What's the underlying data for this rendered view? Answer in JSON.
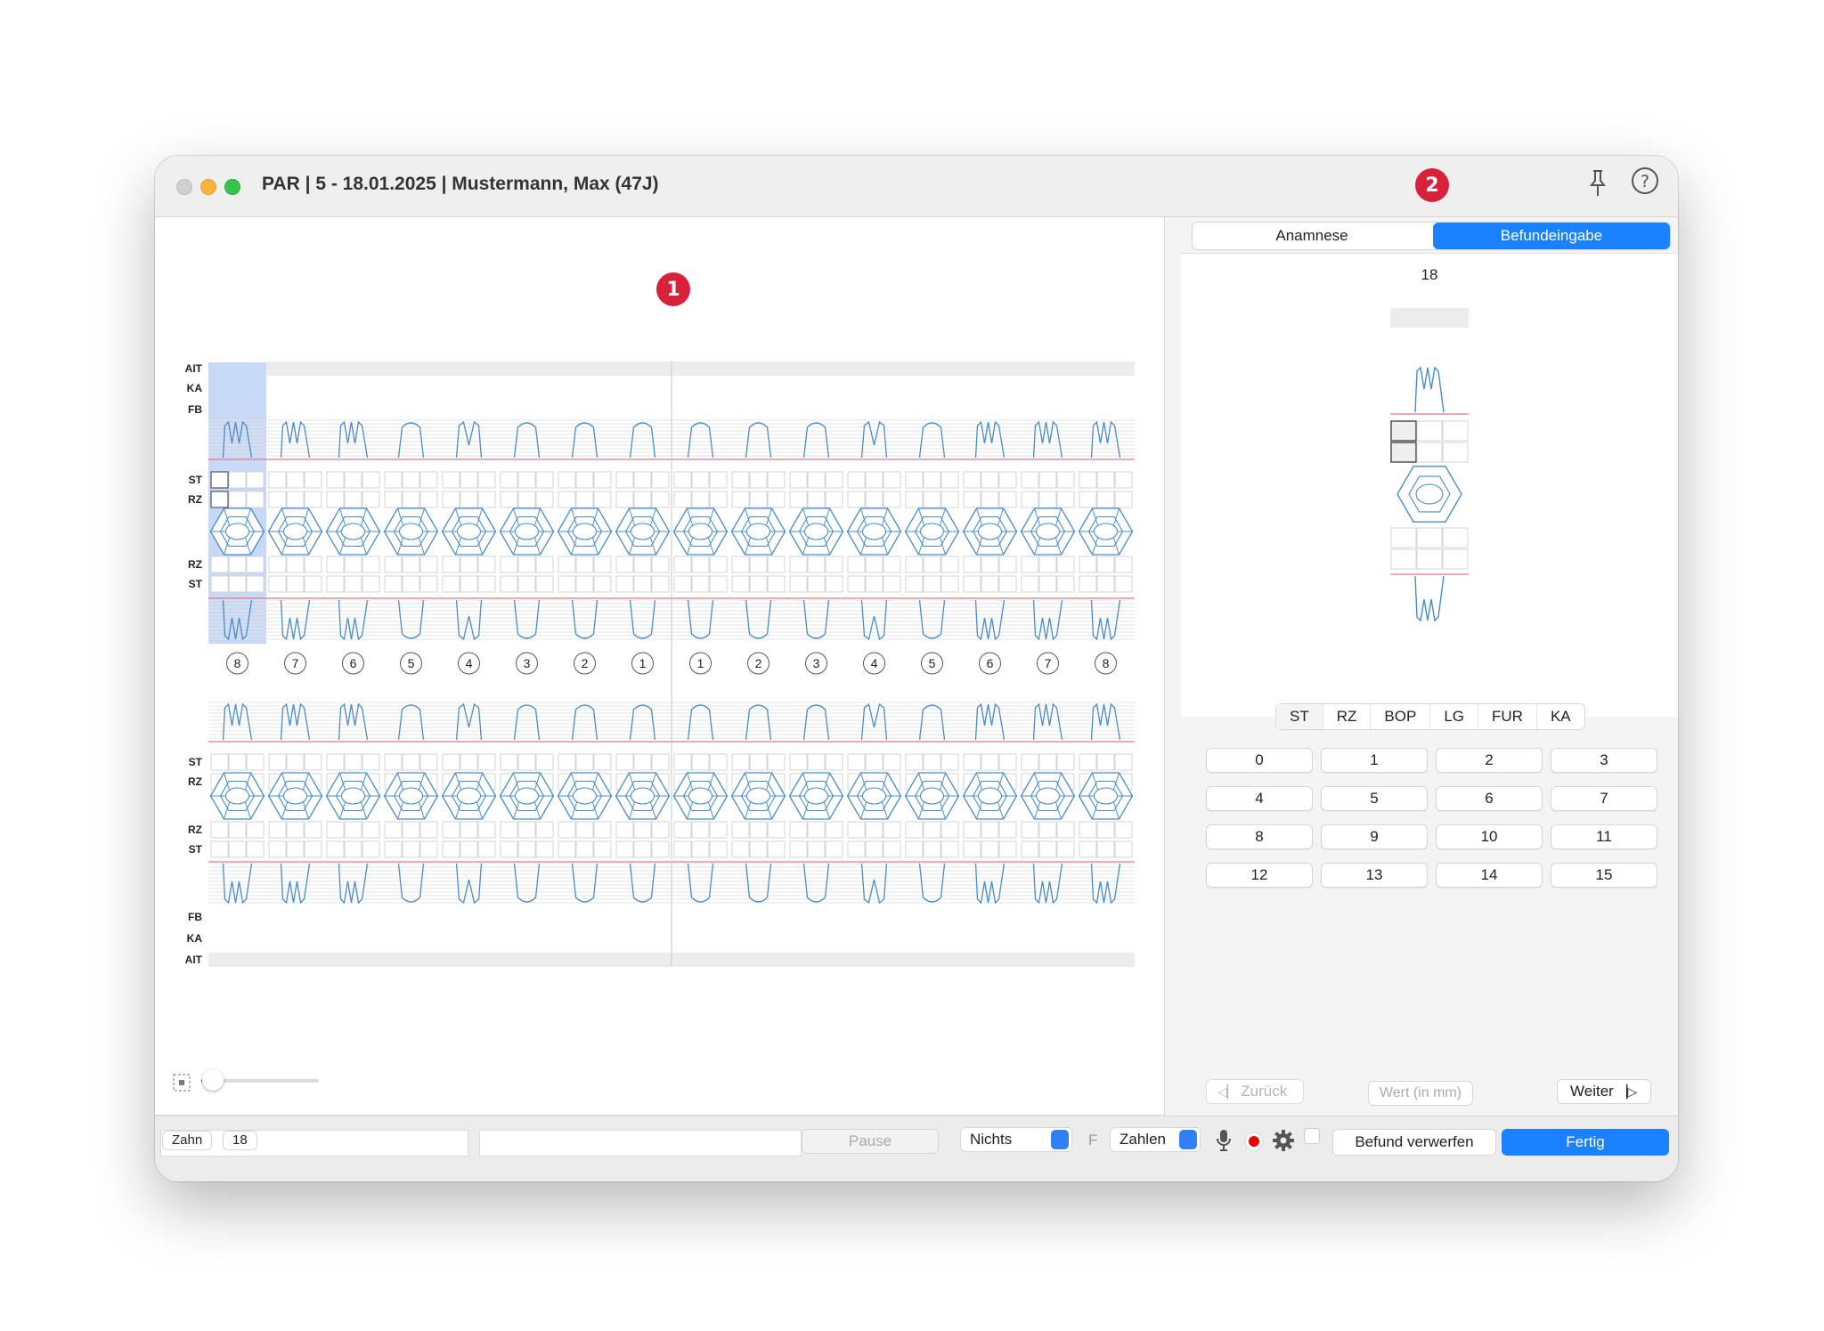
{
  "window": {
    "title": "PAR | 5 - 18.01.2025 | Mustermann, Max (47J)",
    "markers": [
      "1",
      "2"
    ],
    "colors": {
      "accent": "#1a82ff",
      "marker": "#d8223c",
      "tooth_outline": "#4a8ccb",
      "gumline": "#e07a8a",
      "selection": "#c7d9f7"
    }
  },
  "chart": {
    "upper_labels_top": [
      "AIT",
      "KA",
      "FB"
    ],
    "upper_labels_mid": [
      "ST",
      "RZ"
    ],
    "upper_labels_low": [
      "RZ",
      "ST"
    ],
    "lower_labels_mid": [
      "ST",
      "RZ"
    ],
    "lower_labels_low": [
      "RZ",
      "ST"
    ],
    "lower_labels_bottom": [
      "FB",
      "KA",
      "AIT"
    ],
    "tooth_numbers": [
      "8",
      "7",
      "6",
      "5",
      "4",
      "3",
      "2",
      "1",
      "1",
      "2",
      "3",
      "4",
      "5",
      "6",
      "7",
      "8"
    ],
    "root_types": [
      "m",
      "m",
      "m",
      "s",
      "d",
      "s",
      "s",
      "s",
      "s",
      "s",
      "s",
      "d",
      "s",
      "m",
      "m",
      "m"
    ],
    "selected_tooth_index": 0,
    "zoom_level": 0.02
  },
  "panel": {
    "tabs": [
      "Anamnese",
      "Befundeingabe"
    ],
    "active_tab": "Befundeingabe",
    "tooth": "18",
    "measure_tabs": [
      "ST",
      "RZ",
      "BOP",
      "LG",
      "FUR",
      "KA"
    ],
    "active_measure_tab": "ST",
    "values": [
      "0",
      "1",
      "2",
      "3",
      "4",
      "5",
      "6",
      "7",
      "8",
      "9",
      "10",
      "11",
      "12",
      "13",
      "14",
      "15"
    ],
    "back": "Zurück",
    "value_placeholder": "Wert (in mm)",
    "next": "Weiter"
  },
  "bottom": {
    "zahn_label": "Zahn",
    "zahn_value": "18",
    "pause": "Pause",
    "select1": "Nichts",
    "f_label": "F",
    "select2": "Zahlen",
    "discard": "Befund verwerfen",
    "done": "Fertig"
  }
}
